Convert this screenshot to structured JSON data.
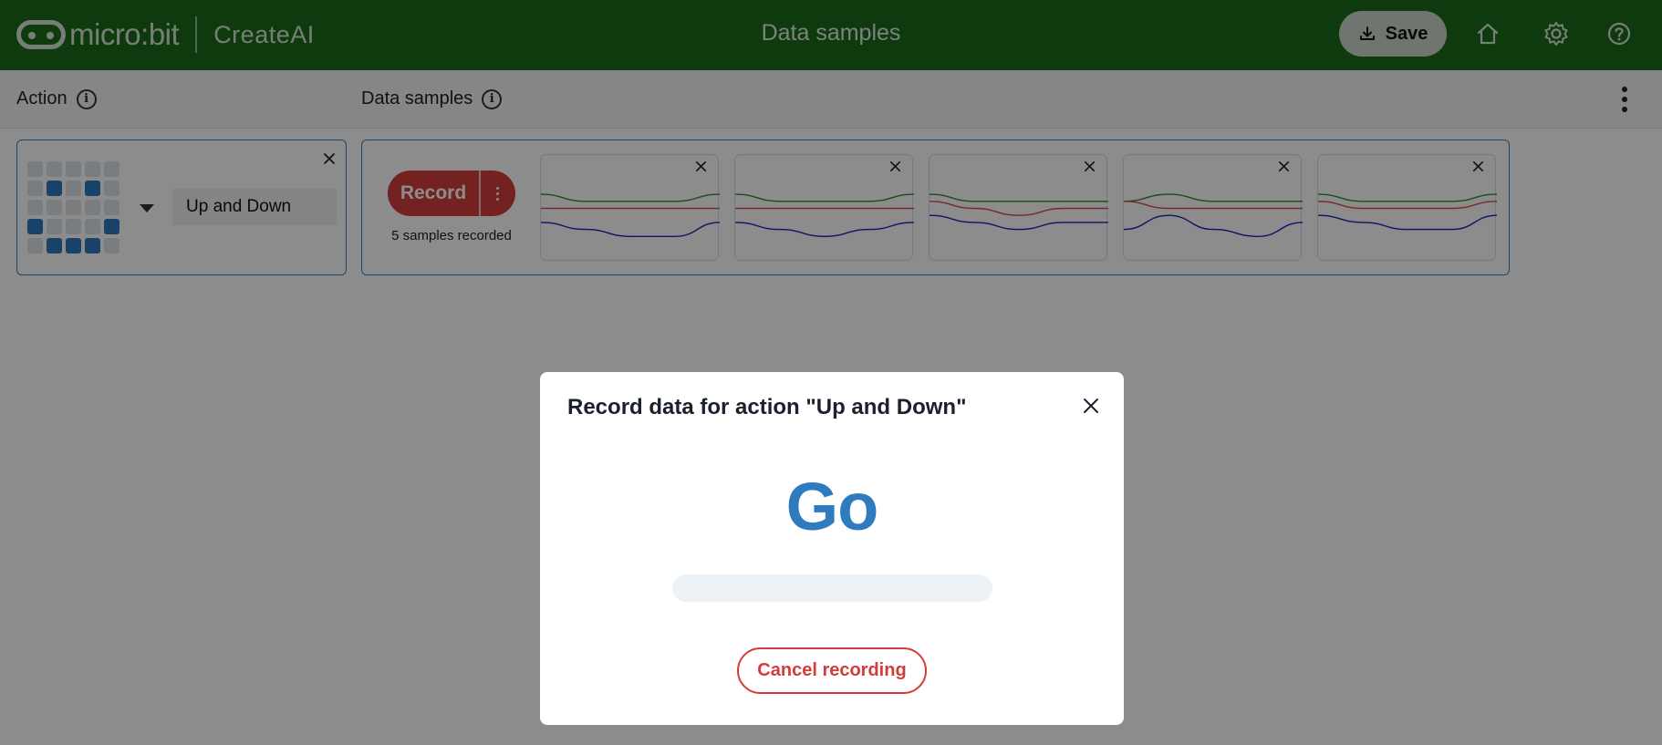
{
  "header": {
    "brand_name": "micro:bit",
    "product_name": "CreateAI",
    "title": "Data samples",
    "save_label": "Save",
    "icons": [
      "download-icon",
      "home-icon",
      "settings-icon",
      "help-icon"
    ],
    "background_color": "#1b6a1b"
  },
  "subheader": {
    "action_label": "Action",
    "samples_label": "Data samples"
  },
  "action": {
    "name": "Up and Down",
    "led_pattern": [
      [
        0,
        0,
        0,
        0,
        0
      ],
      [
        0,
        1,
        0,
        1,
        0
      ],
      [
        0,
        0,
        0,
        0,
        0
      ],
      [
        1,
        0,
        0,
        0,
        1
      ],
      [
        0,
        1,
        1,
        1,
        0
      ]
    ]
  },
  "recording": {
    "record_label": "Record",
    "samples_recorded": "5 samples recorded",
    "samples": [
      {
        "x": [
          2,
          1,
          1,
          1,
          2
        ],
        "y": [
          0,
          0,
          0,
          0,
          0
        ],
        "z": [
          -2,
          -3,
          -4,
          -4,
          -2
        ]
      },
      {
        "x": [
          2,
          1,
          1,
          1,
          2
        ],
        "y": [
          0,
          0,
          0,
          0,
          0
        ],
        "z": [
          -2,
          -3,
          -4,
          -3,
          -2
        ]
      },
      {
        "x": [
          2,
          1,
          1,
          1,
          1
        ],
        "y": [
          1,
          0,
          -1,
          0,
          0
        ],
        "z": [
          -1,
          -2,
          -3,
          -2,
          -2
        ]
      },
      {
        "x": [
          1,
          2,
          1,
          1,
          1
        ],
        "y": [
          1,
          0,
          0,
          0,
          0
        ],
        "z": [
          -3,
          -1,
          -3,
          -4,
          -2
        ]
      },
      {
        "x": [
          2,
          1,
          1,
          1,
          2
        ],
        "y": [
          1,
          0,
          0,
          0,
          1
        ],
        "z": [
          -1,
          -2,
          -3,
          -3,
          -1
        ]
      }
    ]
  },
  "modal": {
    "title": "Record data for action \"Up and Down\"",
    "countdown": "Go",
    "progress": 0,
    "cancel_label": "Cancel recording"
  },
  "colors": {
    "accent_blue": "#2f7bbf",
    "record_red": "#d43c3c",
    "trace_x": "#2e8b2e",
    "trace_y": "#d94a4a",
    "trace_z": "#1f1fb8"
  }
}
